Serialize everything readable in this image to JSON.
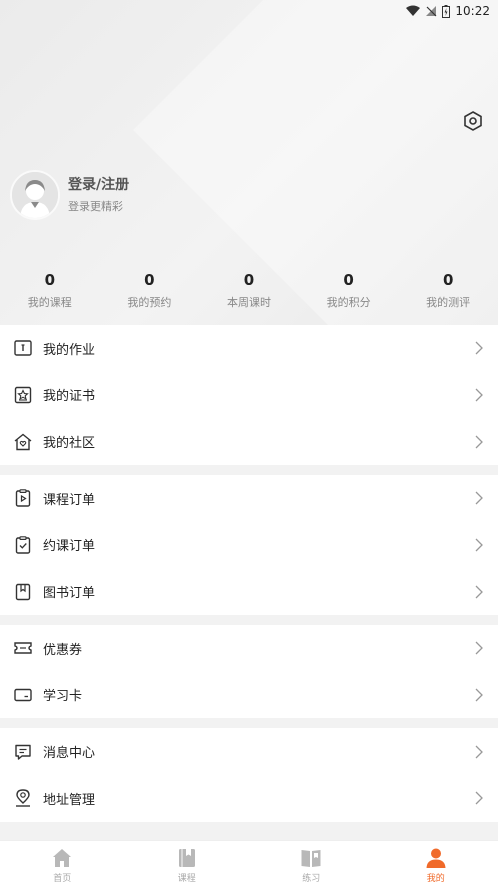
{
  "status_bar": {
    "time": "10:22"
  },
  "profile": {
    "title": "登录/注册",
    "subtitle": "登录更精彩"
  },
  "stats": [
    {
      "value": "0",
      "label": "我的课程"
    },
    {
      "value": "0",
      "label": "我的预约"
    },
    {
      "value": "0",
      "label": "本周课时"
    },
    {
      "value": "0",
      "label": "我的积分"
    },
    {
      "value": "0",
      "label": "我的测评"
    }
  ],
  "menu": {
    "group1": [
      {
        "label": "我的作业",
        "icon": "homework-icon"
      },
      {
        "label": "我的证书",
        "icon": "certificate-icon"
      },
      {
        "label": "我的社区",
        "icon": "community-icon"
      }
    ],
    "group2": [
      {
        "label": "课程订单",
        "icon": "course-order-icon"
      },
      {
        "label": "约课订单",
        "icon": "booking-order-icon"
      },
      {
        "label": "图书订单",
        "icon": "book-order-icon"
      }
    ],
    "group3": [
      {
        "label": "优惠券",
        "icon": "coupon-icon"
      },
      {
        "label": "学习卡",
        "icon": "study-card-icon"
      }
    ],
    "group4": [
      {
        "label": "消息中心",
        "icon": "message-icon"
      },
      {
        "label": "地址管理",
        "icon": "address-icon"
      }
    ]
  },
  "tabbar": [
    {
      "label": "首页",
      "icon": "home-icon"
    },
    {
      "label": "课程",
      "icon": "course-icon"
    },
    {
      "label": "练习",
      "icon": "practice-icon"
    },
    {
      "label": "我的",
      "icon": "profile-icon"
    }
  ],
  "colors": {
    "accent": "#f06a2a",
    "inactive_tab": "#aaaaaa"
  }
}
